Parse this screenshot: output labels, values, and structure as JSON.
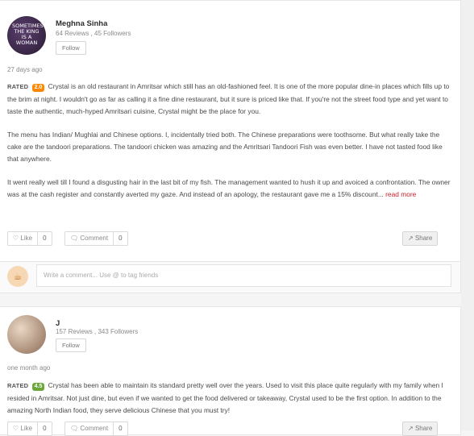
{
  "reviews": [
    {
      "user": {
        "name": "Meghna Sinha",
        "stats": "64 Reviews , 45 Followers",
        "avatar_text": "SOMETIMES THE KING IS A WOMAN"
      },
      "follow_label": "Follow",
      "time": "27 days ago",
      "rated_label": "RATED",
      "rating": "2.0",
      "paragraphs": [
        "Crystal is an old restaurant in Amritsar which still has an old-fashioned feel. It is one of the more popular dine-in places which fills up to the brim at night. I wouldn't go as far as calling it a fine dine restaurant, but it sure is priced like that. If you're not the street food type and yet want to taste the authentic, much-hyped Amritsari cuisine, Crystal might be the place for you.",
        "The menu has Indian/ Mughlai and Chinese options. I, incidentally tried both. The Chinese preparations were toothsome. But what really take the cake are the tandoori preparations. The tandoori chicken was amazing and the Amritsari Tandoori Fish was even better. I have not tasted food like that anywhere.",
        "It went really well till I found a disgusting hair in the last bit of my fish. The management wanted to hush it up and avoiced a confrontation. The owner was at the cash register and constantly averted my gaze. And instead of an apology, the restaurant gave me a 15% discount..."
      ],
      "read_more": "read more",
      "like_label": "Like",
      "like_count": "0",
      "comment_label": "Comment",
      "comment_count": "0",
      "share_label": "Share"
    },
    {
      "user": {
        "name": "J",
        "stats": "157 Reviews , 343 Followers"
      },
      "follow_label": "Follow",
      "time": "one month ago",
      "rated_label": "RATED",
      "rating": "4.5",
      "paragraphs": [
        "Crystal has been able to maintain its standard pretty well over the years. Used to visit this place quite regularly with my family when I resided in Amritsar. Not just dine, but even if we wanted to get the food delivered or takeaway, Crystal used to be the first option. In addition to the amazing North Indian food, they serve delicious Chinese that you must try!"
      ],
      "like_label": "Like",
      "like_count": "0",
      "comment_label": "Comment",
      "comment_count": "0",
      "share_label": "Share"
    }
  ],
  "comment_box": {
    "placeholder": "Write a comment... Use @ to tag friends"
  },
  "colors": {
    "rating_low": "#ff8800",
    "rating_high": "#6ba63a",
    "link": "#cb202d"
  }
}
